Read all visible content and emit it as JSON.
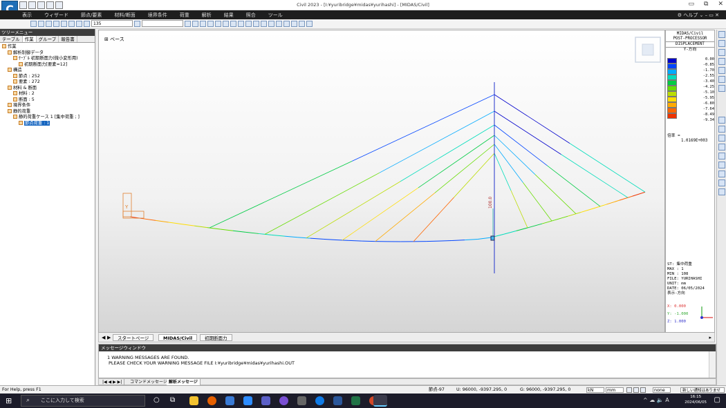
{
  "window": {
    "title": "Civil 2023 - [I:¥yuribridge¥midas¥yurihashi] - [MIDAS/Civil]",
    "app_icon_letter": "C",
    "controls": [
      "▭",
      "⧉",
      "✕"
    ]
  },
  "menu": {
    "items": [
      "表示",
      "ウィザード",
      "節点/要素",
      "材料/断面",
      "境界条件",
      "荷重",
      "解析",
      "結果",
      "照合",
      "ツール"
    ],
    "help": "ヘルプ"
  },
  "toolbar": {
    "combo1_value": "135",
    "combo2_value": ""
  },
  "tree": {
    "header": "ツリーメニュー",
    "tabs": [
      "テーブル",
      "作業",
      "グループ",
      "報告書"
    ],
    "active_tab_index": 1,
    "nodes": [
      {
        "label": "作業",
        "indent": 0
      },
      {
        "label": "解析制御データ",
        "indent": 1
      },
      {
        "label": "ｹｰﾌﾞﾙ 初期断面力(微小変形用)",
        "indent": 2
      },
      {
        "label": "初期断面力[要素=12]",
        "indent": 3
      },
      {
        "label": "構造",
        "indent": 1
      },
      {
        "label": "節点 : 252",
        "indent": 2
      },
      {
        "label": "要素 : 272",
        "indent": 2
      },
      {
        "label": "材料 & 断面",
        "indent": 1
      },
      {
        "label": "材料 : 2",
        "indent": 2
      },
      {
        "label": "断面 : 5",
        "indent": 2
      },
      {
        "label": "境界条件",
        "indent": 1
      },
      {
        "label": "静的荷重",
        "indent": 1
      },
      {
        "label": "静的荷重ケース 1 [集中荷重 ; ]",
        "indent": 2
      },
      {
        "label": "節点荷重 : 1",
        "indent": 3,
        "selected": true
      }
    ]
  },
  "view": {
    "base_label": "ベース",
    "load_label": "100.0"
  },
  "legend": {
    "header": [
      "MIDAS/Civil",
      "POST-PROCESSOR",
      "DISPLACEMENT",
      "Y-方向"
    ],
    "values": [
      "0.00",
      "-0.85",
      "-1.70",
      "-2.55",
      "-3.40",
      "-4.25",
      "-5.10",
      "-5.95",
      "-6.80",
      "-7.64",
      "-8.49",
      "-9.34"
    ],
    "colors": [
      "#0000cc",
      "#0044ff",
      "#00aaff",
      "#00ddbb",
      "#00cc44",
      "#66dd00",
      "#bbdd00",
      "#ffdd00",
      "#ffaa00",
      "#ff6600",
      "#ee3300"
    ],
    "scale_label": "倍率 =",
    "scale_value": "1.0169E+003",
    "info": [
      "ST: 集中荷重",
      "MAX : 1",
      "MIN : 108",
      "FILE: YURIHASHI",
      "UNIT: mm",
      "DATE: 06/05/2024",
      "表示-方向"
    ],
    "axes": [
      "X: 0.000",
      "Y: -1.000",
      "Z: 1.000"
    ]
  },
  "doc_tabs": [
    "スタートページ",
    "MIDAS/Civil",
    "初期断面力"
  ],
  "active_doc_tab": 1,
  "messages": {
    "header": "メッセージウィンドウ",
    "lines": [
      "1 WARNING MESSAGES ARE FOUND.",
      "PLEASE CHECK YOUR WARNING MESSAGE FILE  I:¥yuribridge¥midas¥yurihashi.OUT"
    ],
    "tabs": [
      "コマンドメッセージ",
      "解析メッセージ"
    ]
  },
  "status": {
    "help": "For Help, press F1",
    "node": "節点-97",
    "u": "U: 96000, -9397.295, 0",
    "g": "G: 96000, -9397.295, 0",
    "force_unit": "kN",
    "length_unit": "mm",
    "none": "none",
    "notify": "新しい通知はありません"
  },
  "taskbar": {
    "search_placeholder": "ここに入力して検索",
    "time": "16:15",
    "date": "2024/06/05"
  }
}
